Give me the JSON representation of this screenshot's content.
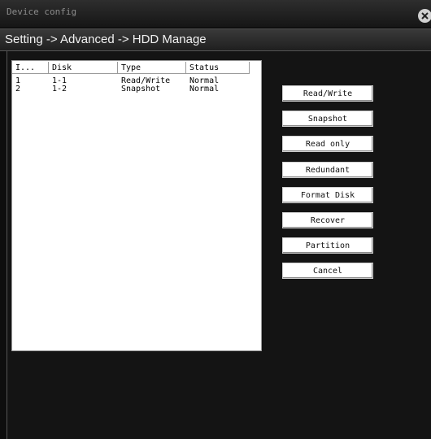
{
  "window": {
    "title": "Device config"
  },
  "breadcrumb": "Setting -> Advanced -> HDD Manage",
  "table": {
    "headers": [
      "I...",
      "Disk",
      "Type",
      "Status"
    ],
    "rows": [
      [
        "1",
        "1-1",
        "Read/Write",
        "Normal"
      ],
      [
        "2",
        "1-2",
        "Snapshot",
        "Normal"
      ]
    ]
  },
  "buttons": {
    "read_write": "Read/Write",
    "snapshot": "Snapshot",
    "read_only": "Read only",
    "redundant": "Redundant",
    "format_disk": "Format Disk",
    "recover": "Recover",
    "partition": "Partition",
    "cancel": "Cancel"
  }
}
